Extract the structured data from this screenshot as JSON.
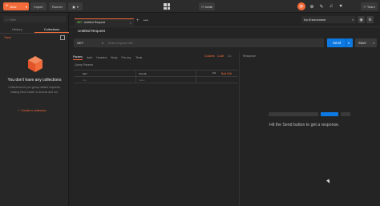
{
  "topbar": {
    "new_label": "New",
    "import_label": "Import",
    "runner_label": "Runner",
    "invite_label": "Invite",
    "team_label": "Team"
  },
  "sidebar": {
    "filter_placeholder": "Filter",
    "tabs": [
      {
        "label": "History"
      },
      {
        "label": "Collections"
      }
    ],
    "trash_label": "Trash",
    "empty_title": "You don't have any collections",
    "empty_desc": "Collections let you group related requests, making them easier to access and run.",
    "create_label": "Create a collection"
  },
  "request_tab": {
    "method": "GET",
    "title": "Untitled Request"
  },
  "environment": {
    "selected": "No Environment"
  },
  "request": {
    "title": "Untitled Request",
    "method": "GET",
    "url_placeholder": "Enter request URL",
    "send_label": "Send",
    "save_label": "Save"
  },
  "subtabs": [
    "Params",
    "Auth",
    "Headers",
    "Body",
    "Pre-req.",
    "Tests"
  ],
  "links": {
    "cookies": "Cookies",
    "code": "Code",
    "comments": "Co"
  },
  "response": {
    "label": "Response",
    "hint": "Hit the Send button to get a response."
  },
  "query_params": {
    "title": "Query Params",
    "headers": {
      "key": "KEY",
      "value": "VALUE"
    },
    "row": {
      "key": "Key",
      "value": "Value"
    },
    "bulk_edit": "Bulk Edit"
  },
  "colors": {
    "accent": "#f26b3a",
    "send": "#0d79e3",
    "background": "#222222"
  }
}
